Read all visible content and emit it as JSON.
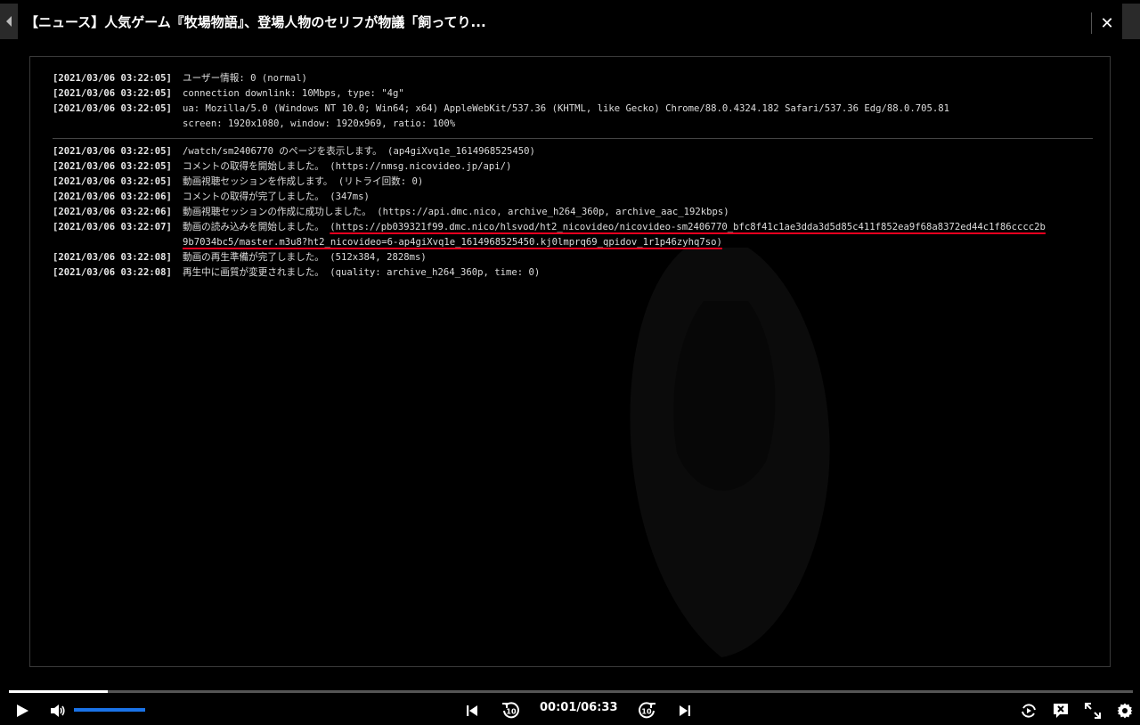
{
  "window": {
    "title": "【ニュース】人気ゲーム『牧場物語』、登場人物のセリフが物議「飼ってり...",
    "close_label": "✕"
  },
  "log": {
    "section1": [
      {
        "ts": "[2021/03/06 03:22:05]",
        "lines": [
          "ユーザー情報: 0 (normal)"
        ]
      },
      {
        "ts": "[2021/03/06 03:22:05]",
        "lines": [
          "connection downlink: 10Mbps, type: \"4g\""
        ]
      },
      {
        "ts": "[2021/03/06 03:22:05]",
        "lines": [
          "ua: Mozilla/5.0 (Windows NT 10.0; Win64; x64) AppleWebKit/537.36 (KHTML, like Gecko) Chrome/88.0.4324.182 Safari/537.36 Edg/88.0.705.81",
          "screen: 1920x1080, window: 1920x969, ratio: 100%"
        ]
      }
    ],
    "section2": [
      {
        "ts": "[2021/03/06 03:22:05]",
        "lines": [
          "/watch/sm2406770 のページを表示します。 (ap4giXvq1e_1614968525450)"
        ]
      },
      {
        "ts": "[2021/03/06 03:22:05]",
        "lines": [
          "コメントの取得を開始しました。 (https://nmsg.nicovideo.jp/api/)"
        ]
      },
      {
        "ts": "[2021/03/06 03:22:05]",
        "lines": [
          "動画視聴セッションを作成します。 (リトライ回数: 0)"
        ]
      },
      {
        "ts": "[2021/03/06 03:22:06]",
        "lines": [
          "コメントの取得が完了しました。 (347ms)"
        ]
      },
      {
        "ts": "[2021/03/06 03:22:06]",
        "lines": [
          "動画視聴セッションの作成に成功しました。 (https://api.dmc.nico, archive_h264_360p, archive_aac_192kbps)"
        ]
      }
    ],
    "highlight_entry": {
      "ts": "[2021/03/06 03:22:07]",
      "prefix": "動画の読み込みを開始しました。 ",
      "url_line1": "(https://pb039321f99.dmc.nico/hlsvod/ht2_nicovideo/nicovideo-sm2406770_bfc8f41c1ae3dda3d5d85c411f852ea9f68a8372ed44c1f86cccc2b",
      "url_line2": "9b7034bc5/master.m3u8?ht2_nicovideo=6-ap4giXvq1e_1614968525450.kj0lmprq69_qpidov_1r1p46zyhq7so)"
    },
    "section3": [
      {
        "ts": "[2021/03/06 03:22:08]",
        "lines": [
          "動画の再生準備が完了しました。 (512x384, 2828ms)"
        ]
      },
      {
        "ts": "[2021/03/06 03:22:08]",
        "lines": [
          "再生中に画質が変更されました。 (quality: archive_h264_360p, time: 0)"
        ]
      }
    ]
  },
  "player": {
    "time_display": "00:01/06:33",
    "seek_progress_percent": 8.8,
    "volume_percent": 100,
    "skip_back_seconds": "10",
    "skip_forward_seconds": "10"
  },
  "colors": {
    "highlight_underline": "#e8001f",
    "volume_fill": "#1a73e8"
  }
}
